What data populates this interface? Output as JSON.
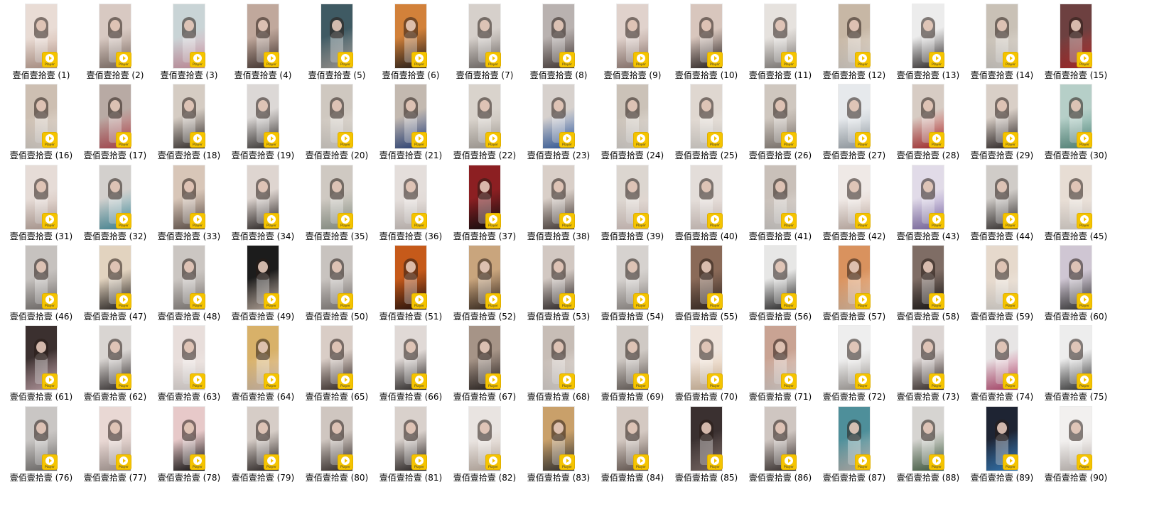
{
  "badge_label": "Player",
  "badge_icon": "play-icon",
  "accent_color": "#f5c400",
  "files": [
    {
      "name": "壹佰壹拾壹 (1)",
      "colors": [
        "#e9dcd5",
        "#caa99a"
      ]
    },
    {
      "name": "壹佰壹拾壹 (2)",
      "colors": [
        "#d8c9c2",
        "#8c7a70"
      ]
    },
    {
      "name": "壹佰壹拾壹 (3)",
      "colors": [
        "#c9d4d6",
        "#e7a6b7"
      ]
    },
    {
      "name": "壹佰壹拾壹 (4)",
      "colors": [
        "#c0a89c",
        "#4a3a35"
      ]
    },
    {
      "name": "壹佰壹拾壹 (5)",
      "colors": [
        "#3f5a63",
        "#b9b3ae"
      ]
    },
    {
      "name": "壹佰壹拾壹 (6)",
      "colors": [
        "#d2813a",
        "#2b2320"
      ]
    },
    {
      "name": "壹佰壹拾壹 (7)",
      "colors": [
        "#d6d0cb",
        "#7b7470"
      ]
    },
    {
      "name": "壹佰壹拾壹 (8)",
      "colors": [
        "#b9b2b0",
        "#4e423f"
      ]
    },
    {
      "name": "壹佰壹拾壹 (9)",
      "colors": [
        "#e0d2cc",
        "#9a8179"
      ]
    },
    {
      "name": "壹佰壹拾壹 (10)",
      "colors": [
        "#d8c6bd",
        "#2e2625"
      ]
    },
    {
      "name": "壹佰壹拾壹 (11)",
      "colors": [
        "#e6e2de",
        "#8f8a86"
      ]
    },
    {
      "name": "壹佰壹拾壹 (12)",
      "colors": [
        "#c7b7a5",
        "#efe9e2"
      ]
    },
    {
      "name": "壹佰壹拾壹 (13)",
      "colors": [
        "#ececec",
        "#353030"
      ]
    },
    {
      "name": "壹佰壹拾壹 (14)",
      "colors": [
        "#c9c1b6",
        "#e7e3de"
      ]
    },
    {
      "name": "壹佰壹拾壹 (15)",
      "colors": [
        "#6d4040",
        "#c73232"
      ]
    },
    {
      "name": "壹佰壹拾壹 (16)",
      "colors": [
        "#cdbfb2",
        "#eee8e1"
      ]
    },
    {
      "name": "壹佰壹拾壹 (17)",
      "colors": [
        "#b8aaa4",
        "#c94f58"
      ]
    },
    {
      "name": "壹佰壹拾壹 (18)",
      "colors": [
        "#d5ccc3",
        "#3b3432"
      ]
    },
    {
      "name": "壹佰壹拾壹 (19)",
      "colors": [
        "#dcd8d6",
        "#3e3a38"
      ]
    },
    {
      "name": "壹佰壹拾壹 (20)",
      "colors": [
        "#cfc8c0",
        "#e8e3dc"
      ]
    },
    {
      "name": "壹佰壹拾壹 (21)",
      "colors": [
        "#c3b9b0",
        "#2d4a8c"
      ]
    },
    {
      "name": "壹佰壹拾壹 (22)",
      "colors": [
        "#d9d3cc",
        "#b9b2aa"
      ]
    },
    {
      "name": "壹佰壹拾壹 (23)",
      "colors": [
        "#d7d1cd",
        "#3566b6"
      ]
    },
    {
      "name": "壹佰壹拾壹 (24)",
      "colors": [
        "#cbc2b8",
        "#eeeae6"
      ]
    },
    {
      "name": "壹佰壹拾壹 (25)",
      "colors": [
        "#dfd7d0",
        "#ece8e2"
      ]
    },
    {
      "name": "壹佰壹拾壹 (26)",
      "colors": [
        "#cfc7bf",
        "#8e857e"
      ]
    },
    {
      "name": "壹佰壹拾壹 (27)",
      "colors": [
        "#e6e9ec",
        "#a9b3bb"
      ]
    },
    {
      "name": "壹佰壹拾壹 (28)",
      "colors": [
        "#d7ccc4",
        "#c52f31"
      ]
    },
    {
      "name": "壹佰壹拾壹 (29)",
      "colors": [
        "#d9cfc7",
        "#2f2828"
      ]
    },
    {
      "name": "壹佰壹拾壹 (30)",
      "colors": [
        "#b6cfc8",
        "#5d9a8c"
      ]
    },
    {
      "name": "壹佰壹拾壹 (31)",
      "colors": [
        "#e6dcd7",
        "#c9b2a8"
      ]
    },
    {
      "name": "壹佰壹拾壹 (32)",
      "colors": [
        "#d3d0cd",
        "#4b9fb1"
      ]
    },
    {
      "name": "壹佰壹拾壹 (33)",
      "colors": [
        "#d8c6b8",
        "#6a5a52"
      ]
    },
    {
      "name": "壹佰壹拾壹 (34)",
      "colors": [
        "#ded5d0",
        "#2b2524"
      ]
    },
    {
      "name": "壹佰壹拾壹 (35)",
      "colors": [
        "#cfc9c2",
        "#9da79a"
      ]
    },
    {
      "name": "壹佰壹拾壹 (36)",
      "colors": [
        "#e4dedb",
        "#dcd2cd"
      ]
    },
    {
      "name": "壹佰壹拾壹 (37)",
      "colors": [
        "#8c1f22",
        "#111111"
      ]
    },
    {
      "name": "壹佰壹拾壹 (38)",
      "colors": [
        "#d9cfc8",
        "#4a3e3a"
      ]
    },
    {
      "name": "壹佰壹拾壹 (39)",
      "colors": [
        "#dcd6d0",
        "#e9d7d2"
      ]
    },
    {
      "name": "壹佰壹拾壹 (40)",
      "colors": [
        "#e3ddd9",
        "#e6d6d0"
      ]
    },
    {
      "name": "壹佰壹拾壹 (41)",
      "colors": [
        "#c9c0b9",
        "#e5e2df"
      ]
    },
    {
      "name": "壹佰壹拾壹 (42)",
      "colors": [
        "#efe9e6",
        "#d9c4b9"
      ]
    },
    {
      "name": "壹佰壹拾壹 (43)",
      "colors": [
        "#e1dbe8",
        "#8a74b9"
      ]
    },
    {
      "name": "壹佰壹拾壹 (44)",
      "colors": [
        "#d0ccc8",
        "#3a3534"
      ]
    },
    {
      "name": "壹佰壹拾壹 (45)",
      "colors": [
        "#e7ddd4",
        "#efe8e2"
      ]
    },
    {
      "name": "壹佰壹拾壹 (46)",
      "colors": [
        "#c6c2bf",
        "#7f7a77"
      ]
    },
    {
      "name": "壹佰壹拾壹 (47)",
      "colors": [
        "#e2d3bf",
        "#2a2624"
      ]
    },
    {
      "name": "壹佰壹拾壹 (48)",
      "colors": [
        "#cbc6c2",
        "#8c8682"
      ]
    },
    {
      "name": "壹佰壹拾壹 (49)",
      "colors": [
        "#1c1c1c",
        "#d9c6b8"
      ]
    },
    {
      "name": "壹佰壹拾壹 (50)",
      "colors": [
        "#c8c3bf",
        "#8a8481"
      ]
    },
    {
      "name": "壹佰壹拾壹 (51)",
      "colors": [
        "#c65a1a",
        "#2a1410"
      ]
    },
    {
      "name": "壹佰壹拾壹 (52)",
      "colors": [
        "#c9a57d",
        "#3a2b22"
      ]
    },
    {
      "name": "壹佰壹拾壹 (53)",
      "colors": [
        "#d2c8c2",
        "#2f2828"
      ]
    },
    {
      "name": "壹佰壹拾壹 (54)",
      "colors": [
        "#d6d2cf",
        "#9a9490"
      ]
    },
    {
      "name": "壹佰壹拾壹 (55)",
      "colors": [
        "#8a6a58",
        "#3a2c26"
      ]
    },
    {
      "name": "壹佰壹拾壹 (56)",
      "colors": [
        "#e7e7e6",
        "#2b2a2a"
      ]
    },
    {
      "name": "壹佰壹拾壹 (57)",
      "colors": [
        "#d9925e",
        "#f3d2b6"
      ]
    },
    {
      "name": "壹佰壹拾壹 (58)",
      "colors": [
        "#7f6d65",
        "#1d1a19"
      ]
    },
    {
      "name": "壹佰壹拾壹 (59)",
      "colors": [
        "#e6d9cc",
        "#f2eee9"
      ]
    },
    {
      "name": "壹佰壹拾壹 (60)",
      "colors": [
        "#cfc6d3",
        "#3a3a3a"
      ]
    },
    {
      "name": "壹佰壹拾壹 (61)",
      "colors": [
        "#3b302f",
        "#d9b7be"
      ]
    },
    {
      "name": "壹佰壹拾壹 (62)",
      "colors": [
        "#d9d5d2",
        "#3a3434"
      ]
    },
    {
      "name": "壹佰壹拾壹 (63)",
      "colors": [
        "#e8dedb",
        "#f3ece9"
      ]
    },
    {
      "name": "壹佰壹拾壹 (64)",
      "colors": [
        "#d8b169",
        "#e9d3c1"
      ]
    },
    {
      "name": "壹佰壹拾壹 (65)",
      "colors": [
        "#d9cdc6",
        "#3a2d29"
      ]
    },
    {
      "name": "壹佰壹拾壹 (66)",
      "colors": [
        "#e0d9d6",
        "#2f2b2a"
      ]
    },
    {
      "name": "壹佰壹拾壹 (67)",
      "colors": [
        "#a69487",
        "#2c2523"
      ]
    },
    {
      "name": "壹佰壹拾壹 (68)",
      "colors": [
        "#c7bdb6",
        "#efe9e5"
      ]
    },
    {
      "name": "壹佰壹拾壹 (69)",
      "colors": [
        "#cfc9c4",
        "#6b625d"
      ]
    },
    {
      "name": "壹佰壹拾壹 (70)",
      "colors": [
        "#efe4dc",
        "#e7c9a8"
      ]
    },
    {
      "name": "壹佰壹拾壹 (71)",
      "colors": [
        "#c9a393",
        "#efe7e3"
      ]
    },
    {
      "name": "壹佰壹拾壹 (72)",
      "colors": [
        "#eeeeee",
        "#b0aaa5"
      ]
    },
    {
      "name": "壹佰壹拾壹 (73)",
      "colors": [
        "#dcd5d3",
        "#3a2e2b"
      ]
    },
    {
      "name": "壹佰壹拾壹 (74)",
      "colors": [
        "#e7e5e5",
        "#c94a78"
      ]
    },
    {
      "name": "壹佰壹拾壹 (75)",
      "colors": [
        "#ededed",
        "#3a3a3a"
      ]
    },
    {
      "name": "壹佰壹拾壹 (76)",
      "colors": [
        "#c9c6c4",
        "#7d7a78"
      ]
    },
    {
      "name": "壹佰壹拾壹 (77)",
      "colors": [
        "#e9d8d4",
        "#b8a9a3"
      ]
    },
    {
      "name": "壹佰壹拾壹 (78)",
      "colors": [
        "#e7c9c9",
        "#111111"
      ]
    },
    {
      "name": "壹佰壹拾壹 (79)",
      "colors": [
        "#d6cdc7",
        "#2e2726"
      ]
    },
    {
      "name": "壹佰壹拾壹 (80)",
      "colors": [
        "#cfc6c0",
        "#3a302d"
      ]
    },
    {
      "name": "壹佰壹拾壹 (81)",
      "colors": [
        "#d9d1cc",
        "#2b2524"
      ]
    },
    {
      "name": "壹佰壹拾壹 (82)",
      "colors": [
        "#e9e4e1",
        "#d1c0b3"
      ]
    },
    {
      "name": "壹佰壹拾壹 (83)",
      "colors": [
        "#c9a06a",
        "#3a3a3a"
      ]
    },
    {
      "name": "壹佰壹拾壹 (84)",
      "colors": [
        "#d4c9c2",
        "#6e5f58"
      ]
    },
    {
      "name": "壹佰壹拾壹 (85)",
      "colors": [
        "#3a3030",
        "#8f7c78"
      ]
    },
    {
      "name": "壹佰壹拾壹 (86)",
      "colors": [
        "#cfc6c1",
        "#3e3533"
      ]
    },
    {
      "name": "壹佰壹拾壹 (87)",
      "colors": [
        "#4e8f9a",
        "#d3cbc6"
      ]
    },
    {
      "name": "壹佰壹拾壹 (88)",
      "colors": [
        "#d6d4d1",
        "#4a6a4a"
      ]
    },
    {
      "name": "壹佰壹拾壹 (89)",
      "colors": [
        "#1e2433",
        "#3f8fd6"
      ]
    },
    {
      "name": "壹佰壹拾壹 (90)",
      "colors": [
        "#f2f0ef",
        "#d6cdc8"
      ]
    }
  ]
}
